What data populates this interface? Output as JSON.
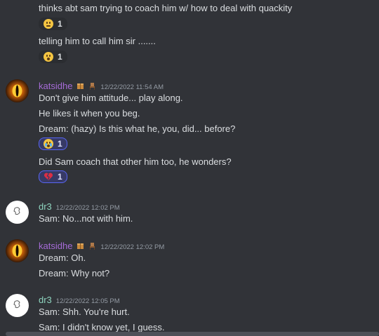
{
  "messages": [
    {
      "lines": [
        "thinks abt sam trying to coach him w/ how to deal with quackity"
      ],
      "reactions": [
        {
          "emoji": "grimace-face-icon",
          "count": "1"
        }
      ]
    },
    {
      "lines": [
        "telling him to call him sir ......."
      ],
      "reactions": [
        {
          "emoji": "astonished-face-icon",
          "count": "1"
        }
      ]
    },
    {
      "author": "katsidhe",
      "timestamp": "12/22/2022 11:54 AM",
      "lines": [
        "Don't give him attitude... play along.",
        "He likes it when you beg.",
        "Dream: (hazy) Is this what he, you, did... before?"
      ],
      "reactions": [
        {
          "emoji": "crying-face-icon",
          "count": "1"
        }
      ]
    },
    {
      "lines": [
        "Did Sam coach that other him too, he wonders?"
      ],
      "reactions": [
        {
          "emoji": "broken-heart-icon",
          "count": "1"
        }
      ]
    },
    {
      "author": "dr3",
      "timestamp": "12/22/2022 12:02 PM",
      "lines": [
        "Sam: No...not with him."
      ]
    },
    {
      "author": "katsidhe",
      "timestamp": "12/22/2022 12:02 PM",
      "lines": [
        "Dream: Oh.",
        "Dream: Why not?"
      ]
    },
    {
      "author": "dr3",
      "timestamp": "12/22/2022 12:05 PM",
      "lines": [
        "Sam: Shh. You're hurt.",
        "Sam: I didn't know yet, I guess."
      ]
    }
  ],
  "colors": {
    "background": "#313338",
    "katsidhe_name": "#a56bd6",
    "dr3_name": "#8fd6c0",
    "reaction_active_border": "#5865f2"
  }
}
